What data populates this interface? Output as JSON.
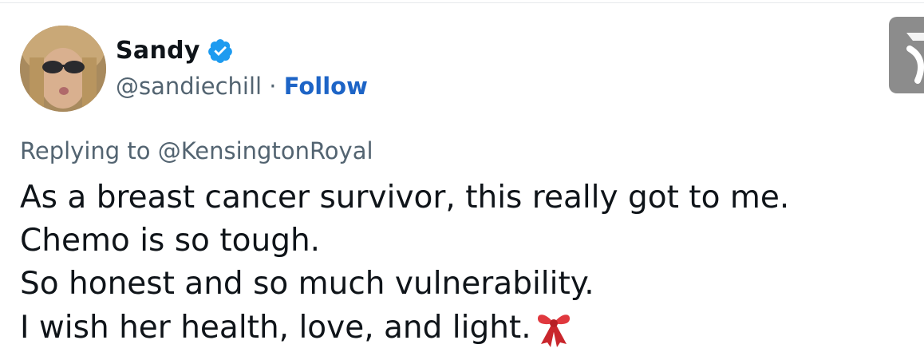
{
  "author": {
    "display_name": "Sandy",
    "handle": "@sandiechill",
    "separator": "·",
    "follow_label": "Follow",
    "verified": true
  },
  "reply": {
    "context": "Replying to @KensingtonRoyal"
  },
  "tweet": {
    "lines": [
      "As a breast cancer survivor, this really got to me.",
      "Chemo is so tough.",
      "So honest and so much vulnerability.",
      "I wish her health, love, and light."
    ],
    "emoji": "ribbon-icon"
  },
  "colors": {
    "text": "#0f1419",
    "secondary": "#536471",
    "follow": "#1d64c6",
    "verified": "#1d9bf0",
    "ribbon": "#e0383e"
  }
}
